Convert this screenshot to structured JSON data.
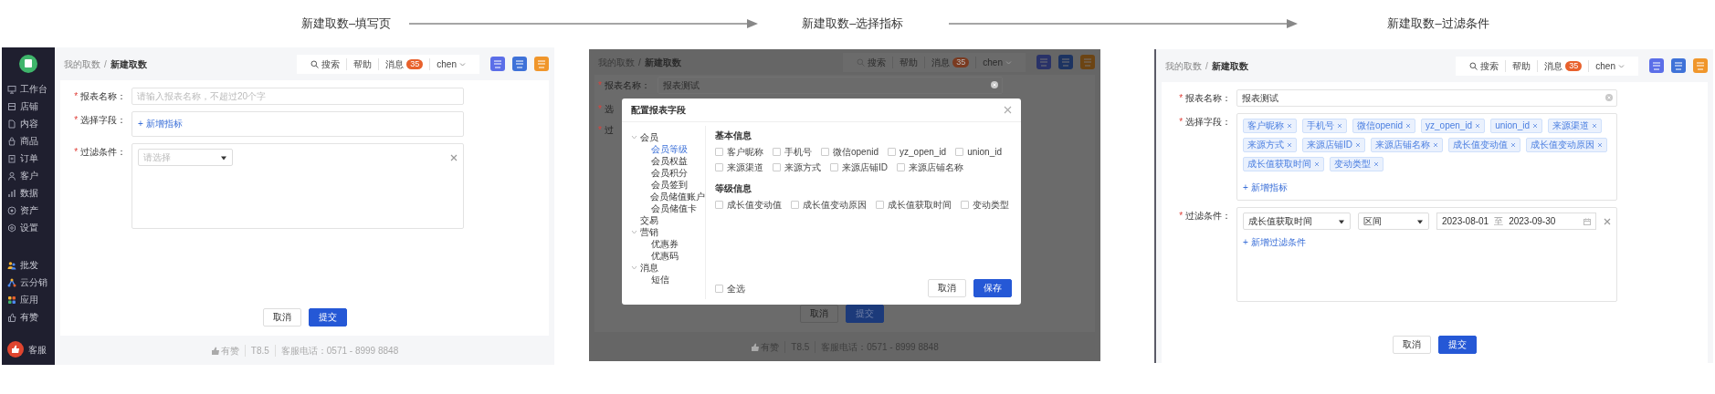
{
  "captions": [
    {
      "text": "新建取数–填写页"
    },
    {
      "text": "新建取数–选择指标"
    },
    {
      "text": "新建取数–过滤条件"
    }
  ],
  "screens": [
    {
      "kind": "page",
      "dimmed": false,
      "sidebar": {
        "items": [
          "工作台",
          "店铺",
          "内容",
          "商品",
          "订单",
          "客户",
          "数据",
          "资产",
          "设置"
        ],
        "apps": [
          "批发",
          "云分销",
          "应用",
          "有赞"
        ],
        "service": "客服"
      },
      "header": {
        "breadcrumb": [
          "我的取数",
          "新建取数"
        ],
        "separator": "/",
        "search": "搜索",
        "help": "帮助",
        "messages": "消息",
        "message_count": "35",
        "user": "chen"
      },
      "fields": [
        {
          "kind": "text",
          "required_mark": "*",
          "label": "报表名称：",
          "placeholder": "请输入报表名称，不超过20个字"
        },
        {
          "kind": "tags",
          "required_mark": "*",
          "label": "选择字段：",
          "add": "+ 新增指标"
        },
        {
          "kind": "filter",
          "required_mark": "*",
          "label": "过滤条件：",
          "rows": [
            {
              "placeholder": "请选择"
            }
          ]
        }
      ],
      "buttons": [
        {
          "label": "取消",
          "kind": "default"
        },
        {
          "label": "提交",
          "kind": "primary"
        }
      ],
      "footer": [
        "有赞",
        "T8.5",
        "客服电话：0571 - 8999 8848"
      ]
    },
    {
      "kind": "dialog",
      "dimmed": true,
      "header": {
        "breadcrumb": [
          "我的取数",
          "新建取数"
        ],
        "separator": "/",
        "search": "搜索",
        "help": "帮助",
        "messages": "消息",
        "message_count": "35",
        "user": "chen"
      },
      "fields": [
        {
          "kind": "text",
          "required_mark": "*",
          "label": "报表名称：",
          "value": "报表测试"
        },
        {
          "kind": "stub",
          "required_mark": "*",
          "label": "选"
        },
        {
          "kind": "stub",
          "required_mark": "*",
          "label": "过"
        }
      ],
      "buttons": [
        {
          "label": "取消",
          "kind": "default"
        },
        {
          "label": "提交",
          "kind": "primary"
        }
      ],
      "footer": [
        "有赞",
        "T8.5",
        "客服电话：0571 - 8999 8848"
      ],
      "dialog": {
        "title": "配置报表字段",
        "tree": [
          {
            "label": "会员",
            "expanded": true,
            "selected": false,
            "children": [
              {
                "label": "会员等级",
                "expanded": false,
                "selected": true
              },
              {
                "label": "会员权益",
                "expanded": false,
                "selected": false
              },
              {
                "label": "会员积分",
                "expanded": false,
                "selected": false
              },
              {
                "label": "会员签到",
                "expanded": false,
                "selected": false
              },
              {
                "label": "会员储值账户",
                "expanded": false,
                "selected": false
              },
              {
                "label": "会员储值卡",
                "expanded": false,
                "selected": false
              }
            ]
          },
          {
            "label": "交易",
            "expanded": false,
            "selected": false
          },
          {
            "label": "营销",
            "expanded": true,
            "selected": false,
            "children": [
              {
                "label": "优惠券",
                "expanded": false,
                "selected": false
              },
              {
                "label": "优惠码",
                "expanded": false,
                "selected": false
              }
            ]
          },
          {
            "label": "消息",
            "expanded": true,
            "selected": false,
            "children": [
              {
                "label": "短信",
                "expanded": false,
                "selected": false
              }
            ]
          }
        ],
        "sections": [
          {
            "title": "基本信息",
            "options": [
              {
                "label": "客户昵称",
                "checked": false
              },
              {
                "label": "手机号",
                "checked": false
              },
              {
                "label": "微信openid",
                "checked": false
              },
              {
                "label": "yz_open_id",
                "checked": false
              },
              {
                "label": "union_id",
                "checked": false
              },
              {
                "label": "来源渠道",
                "checked": false
              },
              {
                "label": "来源方式",
                "checked": false
              },
              {
                "label": "来源店铺ID",
                "checked": false
              },
              {
                "label": "来源店铺名称",
                "checked": false
              }
            ]
          },
          {
            "title": "等级信息",
            "options": [
              {
                "label": "成长值变动值",
                "checked": false
              },
              {
                "label": "成长值变动原因",
                "checked": false
              },
              {
                "label": "成长值获取时间",
                "checked": false
              },
              {
                "label": "变动类型",
                "checked": false
              }
            ]
          }
        ],
        "select_all": {
          "label": "全选",
          "checked": false
        },
        "buttons": [
          {
            "label": "取消",
            "kind": "default"
          },
          {
            "label": "保存",
            "kind": "primary"
          }
        ]
      }
    },
    {
      "kind": "filled",
      "dimmed": false,
      "header": {
        "breadcrumb": [
          "我的取数",
          "新建取数"
        ],
        "separator": "/",
        "search": "搜索",
        "help": "帮助",
        "messages": "消息",
        "message_count": "35",
        "user": "chen"
      },
      "fields": [
        {
          "kind": "text",
          "required_mark": "*",
          "label": "报表名称：",
          "value": "报表测试"
        },
        {
          "kind": "tags",
          "required_mark": "*",
          "label": "选择字段：",
          "tags": [
            "客户昵称",
            "手机号",
            "微信openid",
            "yz_open_id",
            "union_id",
            "来源渠道",
            "来源方式",
            "来源店铺ID",
            "来源店铺名称",
            "成长值变动值",
            "成长值变动原因",
            "成长值获取时间",
            "变动类型"
          ],
          "add": "+ 新增指标"
        },
        {
          "kind": "filter",
          "required_mark": "*",
          "label": "过滤条件：",
          "rows": [
            {
              "field": "成长值获取时间",
              "operator": "区间",
              "start": "2023-08-01",
              "separator": "至",
              "end": "2023-09-30"
            }
          ],
          "add": "+ 新增过滤条件"
        }
      ],
      "buttons": [
        {
          "label": "取消",
          "kind": "default"
        },
        {
          "label": "提交",
          "kind": "primary"
        }
      ]
    }
  ]
}
